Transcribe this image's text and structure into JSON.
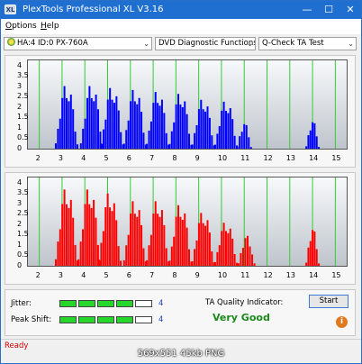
{
  "window": {
    "title": "PlexTools Professional XL V3.16",
    "icon": "plextools-app-icon"
  },
  "title_buttons": {
    "minimize": "—",
    "maximize": "☐",
    "close": "✕"
  },
  "menu": [
    {
      "label": "Options",
      "accel": "O"
    },
    {
      "label": "Help",
      "accel": "H"
    }
  ],
  "toolbar": {
    "drive": "HA:4 ID:0  PX-760A",
    "function": "DVD Diagnostic Functions",
    "test": "Q-Check TA Test"
  },
  "colors": {
    "top_bars": "#0000ff",
    "bottom_bars": "#ff0000",
    "grid_lines": "#33cc33",
    "status": "#d00000",
    "quality": "#1a8a1a"
  },
  "charts": {
    "y_ticks": [
      "4",
      "3.5",
      "3",
      "2.5",
      "2",
      "1.5",
      "1",
      "0.5",
      "0"
    ],
    "x_ticks": [
      "2",
      "3",
      "4",
      "5",
      "6",
      "7",
      "8",
      "9",
      "10",
      "11",
      "12",
      "13",
      "14",
      "15"
    ]
  },
  "chart_data": [
    {
      "type": "bar",
      "series_color": "#0000ff",
      "xlim": [
        1.5,
        15.5
      ],
      "ylim": [
        0,
        4.25
      ],
      "y_ticks": [
        0,
        0.5,
        1,
        1.5,
        2,
        2.5,
        3,
        3.5,
        4
      ],
      "x_ticks": [
        2,
        3,
        4,
        5,
        6,
        7,
        8,
        9,
        10,
        11,
        12,
        13,
        14,
        15
      ],
      "peaks": [
        {
          "x": 3.2,
          "height": 3.2,
          "width": 0.95
        },
        {
          "x": 4.3,
          "height": 3.2,
          "width": 0.95
        },
        {
          "x": 5.2,
          "height": 3.1,
          "width": 0.95
        },
        {
          "x": 6.2,
          "height": 3.0,
          "width": 0.95
        },
        {
          "x": 7.2,
          "height": 2.9,
          "width": 0.95
        },
        {
          "x": 8.2,
          "height": 2.8,
          "width": 0.95
        },
        {
          "x": 9.2,
          "height": 2.5,
          "width": 0.95
        },
        {
          "x": 10.2,
          "height": 2.4,
          "width": 0.95
        },
        {
          "x": 11.0,
          "height": 1.3,
          "width": 0.6
        },
        {
          "x": 14.0,
          "height": 1.4,
          "width": 0.55
        }
      ]
    },
    {
      "type": "bar",
      "series_color": "#ff0000",
      "xlim": [
        1.5,
        15.5
      ],
      "ylim": [
        0,
        4.25
      ],
      "y_ticks": [
        0,
        0.5,
        1,
        1.5,
        2,
        2.5,
        3,
        3.5,
        4
      ],
      "x_ticks": [
        2,
        3,
        4,
        5,
        6,
        7,
        8,
        9,
        10,
        11,
        12,
        13,
        14,
        15
      ],
      "peaks": [
        {
          "x": 3.2,
          "height": 3.9,
          "width": 0.95
        },
        {
          "x": 4.2,
          "height": 3.9,
          "width": 0.95
        },
        {
          "x": 5.1,
          "height": 3.7,
          "width": 0.95
        },
        {
          "x": 6.2,
          "height": 3.3,
          "width": 0.95
        },
        {
          "x": 7.2,
          "height": 3.3,
          "width": 0.95
        },
        {
          "x": 8.2,
          "height": 3.1,
          "width": 0.95
        },
        {
          "x": 9.2,
          "height": 2.7,
          "width": 0.95
        },
        {
          "x": 10.2,
          "height": 2.2,
          "width": 0.95
        },
        {
          "x": 11.1,
          "height": 1.5,
          "width": 0.7
        },
        {
          "x": 14.0,
          "height": 1.9,
          "width": 0.55
        }
      ]
    }
  ],
  "metrics": {
    "jitter": {
      "label": "Jitter:",
      "value": "4",
      "level": 4,
      "max": 5
    },
    "peak_shift": {
      "label": "Peak Shift:",
      "value": "4",
      "level": 4,
      "max": 5
    }
  },
  "ta_quality": {
    "label": "TA Quality Indicator:",
    "value": "Very Good"
  },
  "buttons": {
    "start": "Start",
    "info_icon": "info-icon"
  },
  "status": "Ready",
  "caption": "569x551  45kb  PNG"
}
